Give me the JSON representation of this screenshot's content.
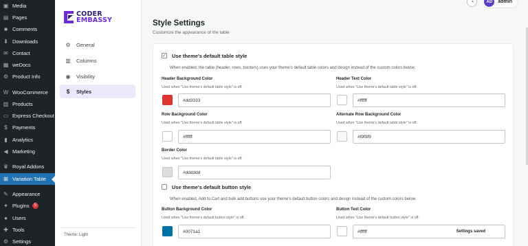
{
  "wp_menu": [
    {
      "label": "Media",
      "icon": "media-icon",
      "glyph": "▣"
    },
    {
      "label": "Pages",
      "icon": "pages-icon",
      "glyph": "▤"
    },
    {
      "label": "Comments",
      "icon": "comments-icon",
      "glyph": "■"
    },
    {
      "label": "Downloads",
      "icon": "downloads-icon",
      "glyph": "⬇"
    },
    {
      "label": "Contact",
      "icon": "contact-icon",
      "glyph": "✉"
    },
    {
      "label": "weDocs",
      "icon": "wedocs-icon",
      "glyph": "▦"
    },
    {
      "label": "Product Info",
      "icon": "product-info-icon",
      "glyph": "⚙"
    },
    {
      "label": "WooCommerce",
      "icon": "woocommerce-icon",
      "glyph": "W"
    },
    {
      "label": "Products",
      "icon": "products-icon",
      "glyph": "▥"
    },
    {
      "label": "Express Checkout",
      "icon": "express-checkout-icon",
      "glyph": "▭"
    },
    {
      "label": "Payments",
      "icon": "payments-icon",
      "glyph": "$"
    },
    {
      "label": "Analytics",
      "icon": "analytics-icon",
      "glyph": "▮"
    },
    {
      "label": "Marketing",
      "icon": "marketing-icon",
      "glyph": "◀"
    },
    {
      "label": "Royal Addons",
      "icon": "royal-addons-icon",
      "glyph": "♛"
    },
    {
      "label": "Variation Table",
      "icon": "variation-table-icon",
      "glyph": "⊞",
      "active": true
    },
    {
      "label": "Appearance",
      "icon": "appearance-icon",
      "glyph": "✎"
    },
    {
      "label": "Plugins",
      "icon": "plugins-icon",
      "glyph": "✦",
      "badge": "5"
    },
    {
      "label": "Users",
      "icon": "users-icon",
      "glyph": "●"
    },
    {
      "label": "Tools",
      "icon": "tools-icon",
      "glyph": "✚"
    },
    {
      "label": "Settings",
      "icon": "settings-icon",
      "glyph": "⚙"
    }
  ],
  "brand": {
    "line1": "CODER",
    "line2": "EMBASSY"
  },
  "plugin_nav": [
    {
      "label": "General",
      "icon": "gear-icon",
      "glyph": "⚙"
    },
    {
      "label": "Columns",
      "icon": "columns-icon",
      "glyph": "▥"
    },
    {
      "label": "Visibility",
      "icon": "eye-icon",
      "glyph": "◉"
    },
    {
      "label": "Styles",
      "icon": "dollar-icon",
      "glyph": "$",
      "active": true
    }
  ],
  "theme_label": "Theme: Light",
  "topbar": {
    "user": "admin",
    "avatar_initials": "AD"
  },
  "page": {
    "title": "Style Settings",
    "subtitle": "Customize the appearance of the table"
  },
  "table_style": {
    "label": "Use theme's default table style",
    "checked": true,
    "description": "When enabled, the table (header, rows, borders) uses your theme's default table colors and design instead of the custom colors below."
  },
  "table_fields": {
    "header_bg": {
      "label": "Header Background Color",
      "hint": "Used when \"Use theme's default table style\" is off.",
      "value": "#dd3333"
    },
    "header_text": {
      "label": "Header Text Color",
      "hint": "Used when \"Use theme's default table style\" is off.",
      "value": "#ffffff"
    },
    "row_bg": {
      "label": "Row Background Color",
      "hint": "Used when \"Use theme's default table style\" is off.",
      "value": "#ffffff"
    },
    "alt_row_bg": {
      "label": "Alternate Row Background Color",
      "hint": "Used when \"Use theme's default table style\" is off.",
      "value": "#f9f9f9"
    },
    "border": {
      "label": "Border Color",
      "hint": "Used when \"Use theme's default table style\" is off.",
      "value": "#dddddd"
    }
  },
  "button_style": {
    "label": "Use theme's default button style",
    "checked": false,
    "description": "When enabled, Add to Cart and bulk add buttons use your theme's default button colors and design instead of the custom colors below."
  },
  "button_fields": {
    "btn_bg": {
      "label": "Button Background Color",
      "hint": "Used when \"Use theme's default button style\" is off.",
      "value": "#0071a1"
    },
    "btn_text": {
      "label": "Button Text Color",
      "hint": "Used when \"Use theme's default button style\" is off.",
      "value": "#ffffff"
    }
  },
  "toast": "Settings saved",
  "colors": {
    "brand_purple": "#6c2bd9",
    "wp_active": "#2271b1",
    "nav_active_bg": "#ebe8fb"
  }
}
